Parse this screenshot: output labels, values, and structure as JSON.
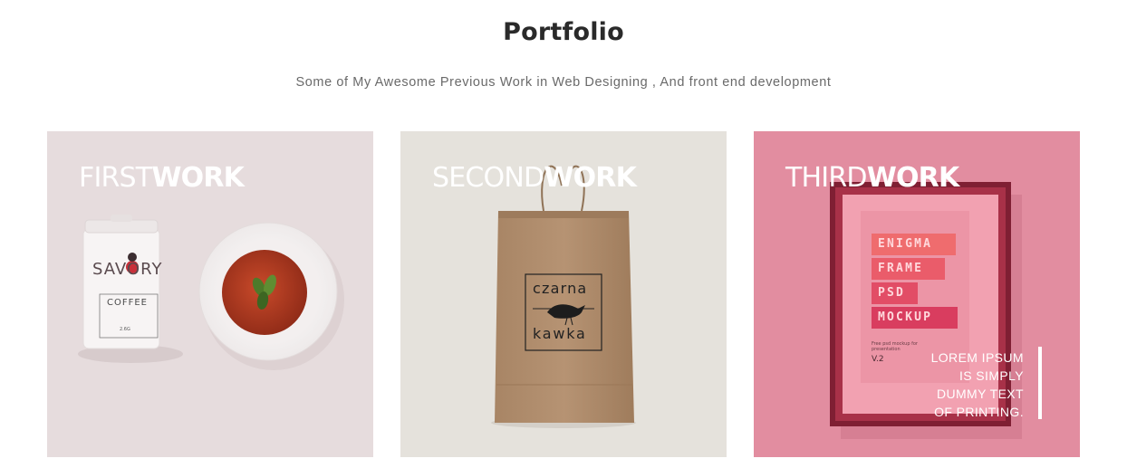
{
  "section": {
    "title": "Portfolio",
    "subtitle": "Some of My Awesome Previous Work in Web Designing , And front end development"
  },
  "cards": [
    {
      "title_light": "FIRST",
      "title_bold": "WORK",
      "background": "#e6dcdd",
      "art": {
        "brand": "SAVORY",
        "label": "COFFEE",
        "weight": "2.6G"
      }
    },
    {
      "title_light": "SECOND",
      "title_bold": "WORK",
      "background": "#e5e2dc",
      "art": {
        "word1": "czarna",
        "word2": "kawka"
      }
    },
    {
      "title_light": "THIRD",
      "title_bold": "WORK",
      "background": "#e28da0",
      "art": {
        "tags": [
          "ENIGMA",
          "FRAME",
          "PSD",
          "MOCKUP"
        ],
        "small_text": "Free psd mockup for presentation",
        "version": "V.2"
      },
      "caption_lines": [
        "LOREM IPSUM",
        "IS SIMPLY",
        "DUMMY TEXT",
        "OF PRINTING."
      ]
    }
  ]
}
